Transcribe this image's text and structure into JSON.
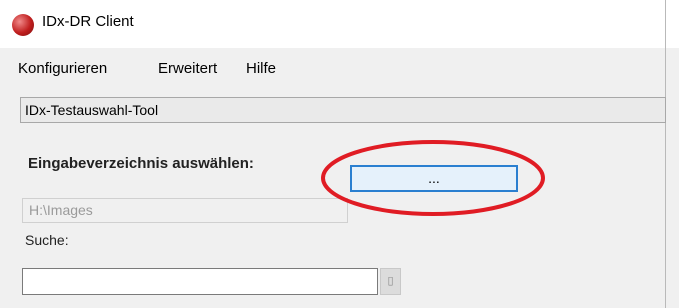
{
  "window": {
    "title": "IDx-DR Client",
    "app_icon": "red-circle-app-icon"
  },
  "menu": {
    "items": [
      "Konfigurieren",
      "Erweitert",
      "Hilfe"
    ]
  },
  "tool": {
    "header_label": "IDx-Testauswahl-Tool"
  },
  "input_directory": {
    "label": "Eingabeverzeichnis auswählen:",
    "browse_label": "...",
    "path_value": "H:\\Images"
  },
  "search": {
    "label": "Suche:",
    "value": "",
    "button_icon": "dropdown-glyph"
  },
  "colors": {
    "annotation": "#e01c24",
    "button_border": "#2a7fd0"
  }
}
